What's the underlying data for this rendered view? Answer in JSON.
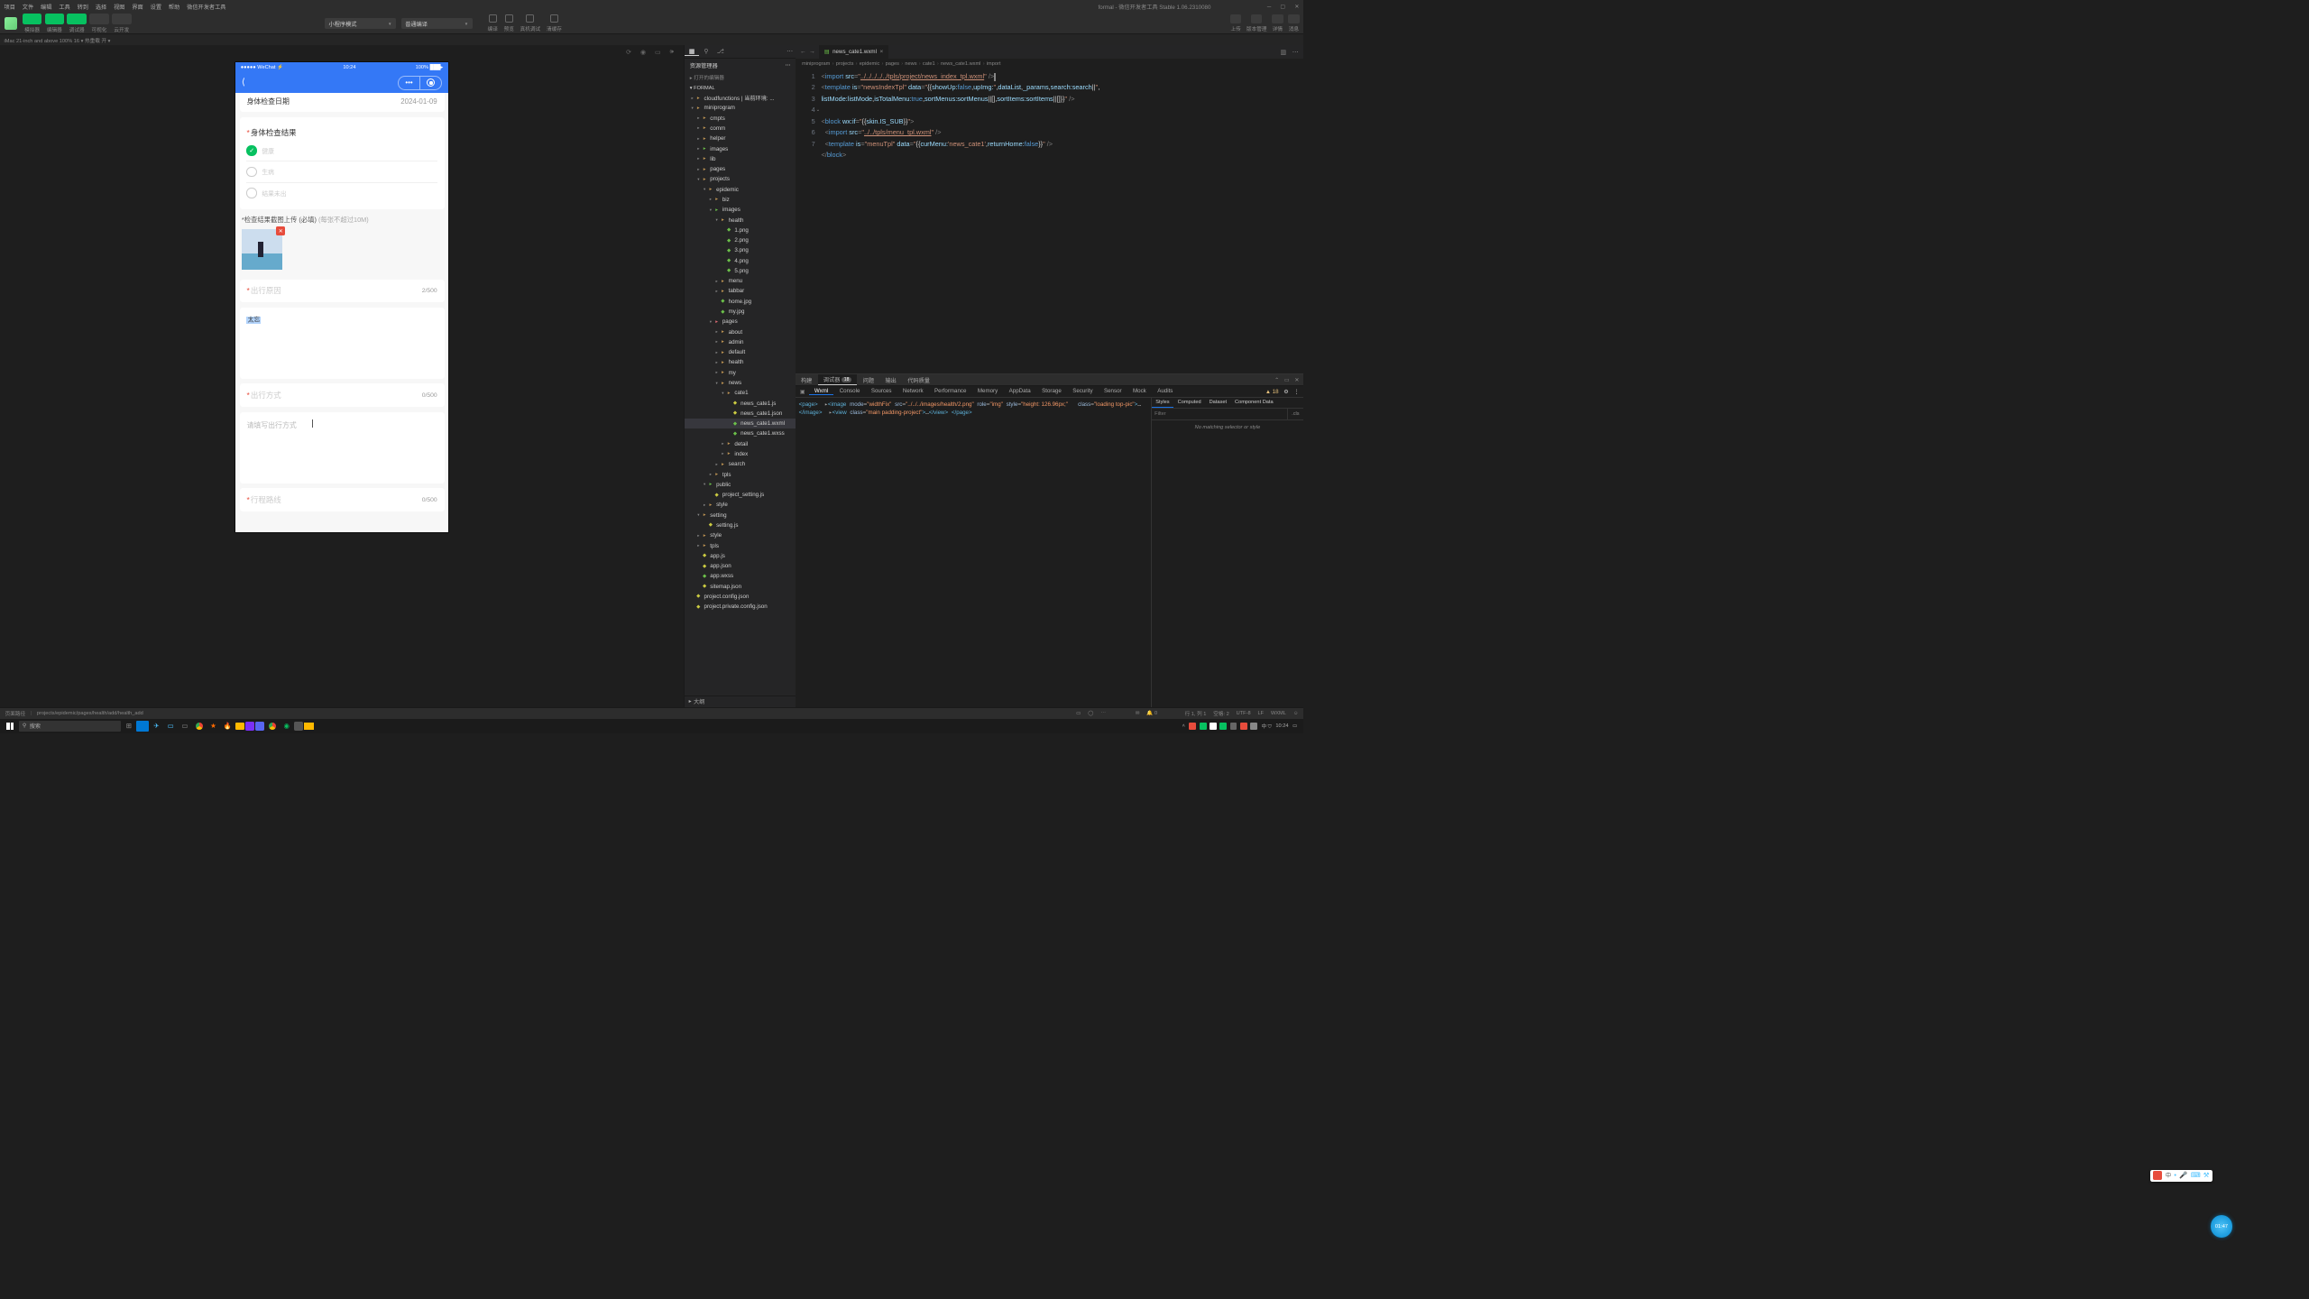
{
  "menubar": {
    "items": [
      "项目",
      "文件",
      "编辑",
      "工具",
      "转到",
      "选择",
      "视图",
      "界面",
      "设置",
      "帮助",
      "微信开发者工具"
    ],
    "title": "formal - 微信开发者工具 Stable 1.06.2310080"
  },
  "toolbar": {
    "modes": [
      {
        "label": "模拟器"
      },
      {
        "label": "编辑器"
      },
      {
        "label": "调试器"
      },
      {
        "label": "可视化"
      },
      {
        "label": "云开发"
      }
    ],
    "dropdown1": "小程序模式",
    "dropdown2": "普通编译",
    "center_btns": [
      "编译",
      "预览",
      "真机调试",
      "清缓存"
    ],
    "right_btns": [
      "上传",
      "版本管理",
      "详情",
      "消息"
    ]
  },
  "sim_status": "iMac 21-inch and above 100% 16 ▾    热重载 开 ▾",
  "phone": {
    "status_left": "●●●●● WeChat ⚡",
    "status_time": "10:24",
    "status_right": "100% ███▸",
    "fields": {
      "date_label": "身体检查日期",
      "date_value": "2024-01-09",
      "result_title": "身体检查结果",
      "opt1": "健康",
      "opt2": "生病",
      "opt3": "结果未出",
      "upload_label_a": "*检查结果截图上传 (必填)",
      "upload_label_b": "(每张不超过10M)",
      "reason_label": "出行原因",
      "reason_count": "2/500",
      "reason_text": "太忘",
      "way_label": "出行方式",
      "way_count": "0/500",
      "way_placeholder": "请填写出行方式",
      "route_label": "行程路线",
      "route_count": "0/500"
    }
  },
  "explorer": {
    "header": "资源管理器",
    "section1": "打开的编辑器",
    "project": "FORMAL"
  },
  "tree": [
    {
      "d": 0,
      "t": "cloudfunctions | 当前环境: ...",
      "i": "folder-c",
      "c": "▸"
    },
    {
      "d": 0,
      "t": "miniprogram",
      "i": "folder-c",
      "c": "▾"
    },
    {
      "d": 1,
      "t": "cmpts",
      "i": "folder-c",
      "c": "▸"
    },
    {
      "d": 1,
      "t": "comm",
      "i": "folder-c",
      "c": "▸"
    },
    {
      "d": 1,
      "t": "helper",
      "i": "folder-c",
      "c": "▸"
    },
    {
      "d": 1,
      "t": "images",
      "i": "folder-img",
      "c": "▸"
    },
    {
      "d": 1,
      "t": "lib",
      "i": "folder-c",
      "c": "▸"
    },
    {
      "d": 1,
      "t": "pages",
      "i": "folder-c",
      "c": "▸"
    },
    {
      "d": 1,
      "t": "projects",
      "i": "folder-c",
      "c": "▾"
    },
    {
      "d": 2,
      "t": "epidemic",
      "i": "folder-c",
      "c": "▾"
    },
    {
      "d": 3,
      "t": "biz",
      "i": "folder-c",
      "c": "▸"
    },
    {
      "d": 3,
      "t": "images",
      "i": "folder-img",
      "c": "▾"
    },
    {
      "d": 4,
      "t": "health",
      "i": "folder-c",
      "c": "▾"
    },
    {
      "d": 5,
      "t": "1.png",
      "i": "file-wxml",
      "c": " "
    },
    {
      "d": 5,
      "t": "2.png",
      "i": "file-wxml",
      "c": " "
    },
    {
      "d": 5,
      "t": "3.png",
      "i": "file-wxml",
      "c": " "
    },
    {
      "d": 5,
      "t": "4.png",
      "i": "file-wxml",
      "c": " "
    },
    {
      "d": 5,
      "t": "5.png",
      "i": "file-wxml",
      "c": " "
    },
    {
      "d": 4,
      "t": "menu",
      "i": "folder-c",
      "c": "▸"
    },
    {
      "d": 4,
      "t": "tabbar",
      "i": "folder-c",
      "c": "▸"
    },
    {
      "d": 4,
      "t": "home.jpg",
      "i": "file-wxml",
      "c": " "
    },
    {
      "d": 4,
      "t": "my.jpg",
      "i": "file-wxml",
      "c": " "
    },
    {
      "d": 3,
      "t": "pages",
      "i": "folder-red",
      "c": "▾"
    },
    {
      "d": 4,
      "t": "about",
      "i": "folder-c",
      "c": "▸"
    },
    {
      "d": 4,
      "t": "admin",
      "i": "folder-c",
      "c": "▸"
    },
    {
      "d": 4,
      "t": "default",
      "i": "folder-c",
      "c": "▸"
    },
    {
      "d": 4,
      "t": "health",
      "i": "folder-c",
      "c": "▸"
    },
    {
      "d": 4,
      "t": "my",
      "i": "folder-c",
      "c": "▸"
    },
    {
      "d": 4,
      "t": "news",
      "i": "folder-c",
      "c": "▾"
    },
    {
      "d": 5,
      "t": "cate1",
      "i": "folder-c",
      "c": "▾"
    },
    {
      "d": 6,
      "t": "news_cate1.js",
      "i": "file-js",
      "c": " "
    },
    {
      "d": 6,
      "t": "news_cate1.json",
      "i": "file-json",
      "c": " "
    },
    {
      "d": 6,
      "t": "news_cate1.wxml",
      "i": "file-wxml",
      "c": " ",
      "sel": true
    },
    {
      "d": 6,
      "t": "news_cate1.wxss",
      "i": "file-wxss",
      "c": " "
    },
    {
      "d": 5,
      "t": "detail",
      "i": "folder-c",
      "c": "▸"
    },
    {
      "d": 5,
      "t": "index",
      "i": "folder-c",
      "c": "▸"
    },
    {
      "d": 4,
      "t": "search",
      "i": "folder-c",
      "c": "▸"
    },
    {
      "d": 3,
      "t": "tpls",
      "i": "folder-c",
      "c": "▸"
    },
    {
      "d": 2,
      "t": "public",
      "i": "folder-img",
      "c": "▾"
    },
    {
      "d": 3,
      "t": "project_setting.js",
      "i": "file-js",
      "c": " "
    },
    {
      "d": 2,
      "t": "style",
      "i": "folder-c",
      "c": "▸"
    },
    {
      "d": 1,
      "t": "setting",
      "i": "folder-c",
      "c": "▾"
    },
    {
      "d": 2,
      "t": "setting.js",
      "i": "file-js",
      "c": " "
    },
    {
      "d": 1,
      "t": "style",
      "i": "folder-c",
      "c": "▸"
    },
    {
      "d": 1,
      "t": "tpls",
      "i": "folder-c",
      "c": "▸"
    },
    {
      "d": 1,
      "t": "app.js",
      "i": "file-js",
      "c": " "
    },
    {
      "d": 1,
      "t": "app.json",
      "i": "file-json",
      "c": " "
    },
    {
      "d": 1,
      "t": "app.wxss",
      "i": "file-wxss",
      "c": " "
    },
    {
      "d": 1,
      "t": "sitemap.json",
      "i": "file-json",
      "c": " "
    },
    {
      "d": 0,
      "t": "project.config.json",
      "i": "file-json",
      "c": " "
    },
    {
      "d": 0,
      "t": "project.private.config.json",
      "i": "file-json",
      "c": " "
    }
  ],
  "outline": "大纲",
  "editor": {
    "tab": "news_cate1.wxml",
    "breadcrumb": [
      "miniprogram",
      "projects",
      "epidemic",
      "pages",
      "news",
      "cate1",
      "news_cate1.wxml",
      "import"
    ]
  },
  "dev": {
    "top_tabs": [
      "构建",
      "调试器",
      "问题",
      "输出",
      "代码质量"
    ],
    "badge": "18",
    "sub_tabs": [
      "Wxml",
      "Console",
      "Sources",
      "Network",
      "Performance",
      "Memory",
      "AppData",
      "Storage",
      "Security",
      "Sensor",
      "Mock",
      "Audits"
    ],
    "warnings": "18",
    "styles_tabs": [
      "Styles",
      "Computed",
      "Dataset",
      "Component Data"
    ],
    "filter_placeholder": "Filter",
    "cls": ".cls",
    "nomatch": "No matching selector or style"
  },
  "page_path": {
    "label": "页面路径",
    "path": "projects/epidemic/pages/health/add/health_add"
  },
  "ed_status": [
    "行 1, 列 1",
    "空格: 2",
    "UTF-8",
    "LF",
    "WXML"
  ],
  "taskbar": {
    "search": "搜索",
    "time": "10:24"
  },
  "timer": "01:47"
}
